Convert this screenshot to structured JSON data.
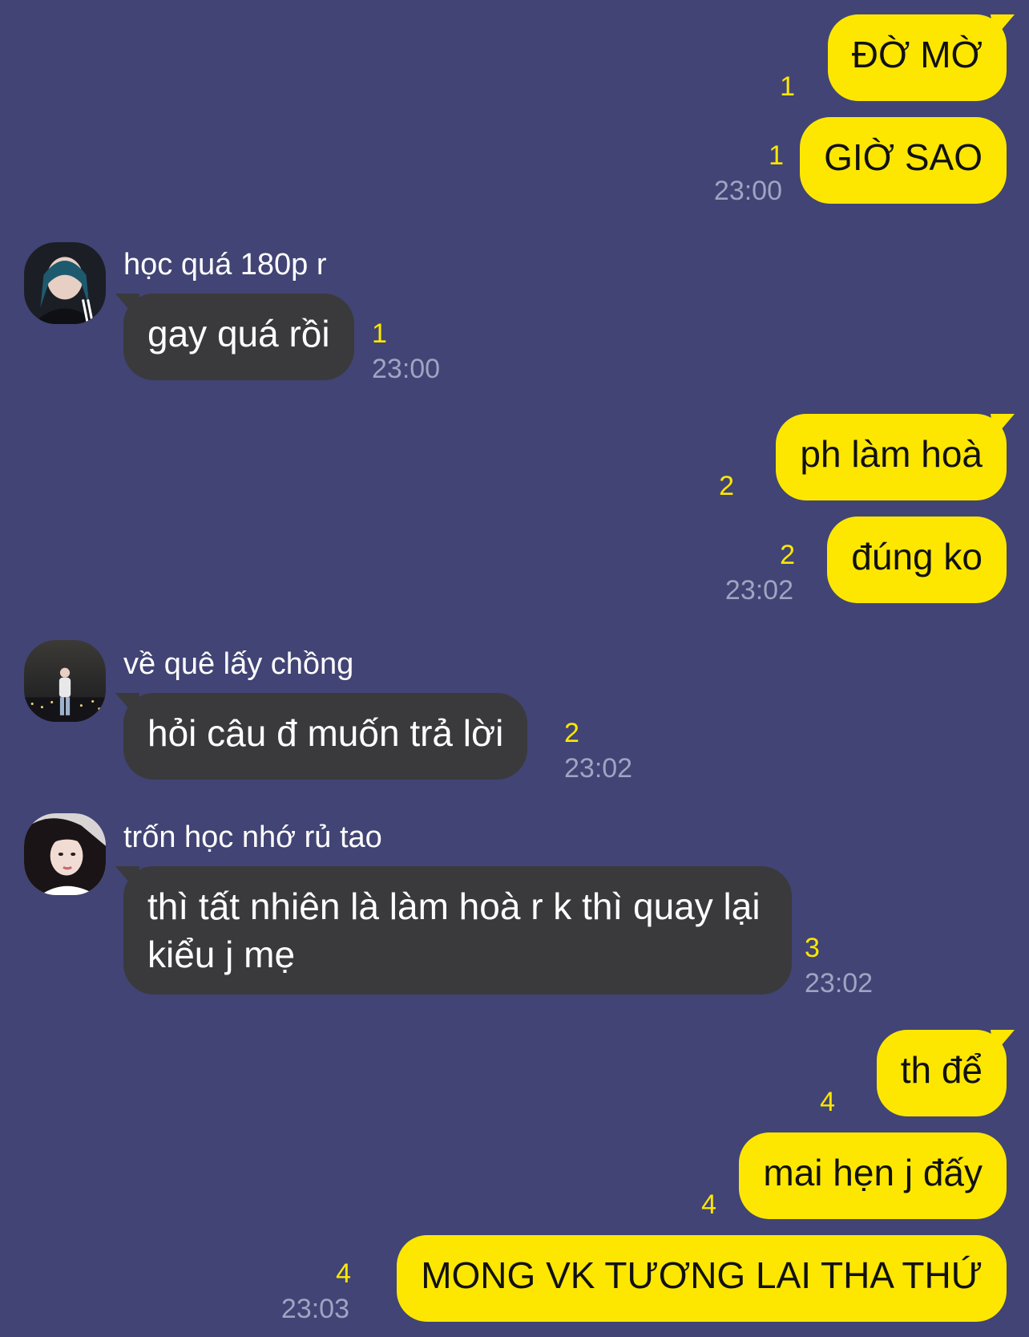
{
  "theme": {
    "background": "#414474",
    "outgoing_bubble": "#fde700",
    "incoming_bubble": "#3a3a3c",
    "unread_color": "#fde700",
    "time_color": "#a0a3c2"
  },
  "messages": [
    {
      "text": "ĐỜ MỜ",
      "unread": "1"
    },
    {
      "text": "GIỜ SAO",
      "unread": "1",
      "time": "23:00"
    },
    {
      "sender": "học quá 180p r",
      "avatar": "avatar-photo-icon",
      "text": "gay quá rồi",
      "unread": "1",
      "time": "23:00"
    },
    {
      "text": "ph làm hoà",
      "unread": "2"
    },
    {
      "text": "đúng ko",
      "unread": "2",
      "time": "23:02"
    },
    {
      "sender": "về quê lấy chồng",
      "avatar": "avatar-photo-icon",
      "text": "hỏi câu đ muốn trả lời",
      "unread": "2",
      "time": "23:02"
    },
    {
      "sender": "trốn học nhớ rủ tao",
      "avatar": "avatar-photo-icon",
      "text": "thì tất nhiên là làm hoà r k thì quay lại kiểu j mẹ",
      "unread": "3",
      "time": "23:02"
    },
    {
      "text": "th để",
      "unread": "4"
    },
    {
      "text": "mai hẹn j đấy",
      "unread": "4"
    },
    {
      "text": "MONG VK TƯƠNG LAI THA THỨ",
      "unread": "4",
      "time": "23:03"
    }
  ]
}
